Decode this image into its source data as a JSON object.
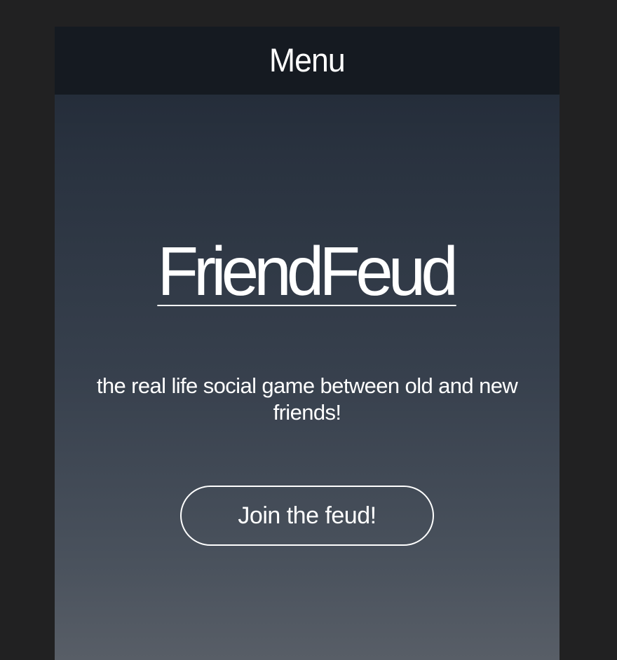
{
  "nav": {
    "menu_label": "Menu"
  },
  "hero": {
    "title": "FriendFeud",
    "tagline": "the real life social game between old and new friends!",
    "cta_label": "Join the feud!"
  },
  "colors": {
    "page_background": "#212122",
    "nav_background": "#151a21",
    "hero_gradient_top": "#1f2734",
    "hero_gradient_bottom": "#585e67",
    "text": "#ffffff"
  }
}
